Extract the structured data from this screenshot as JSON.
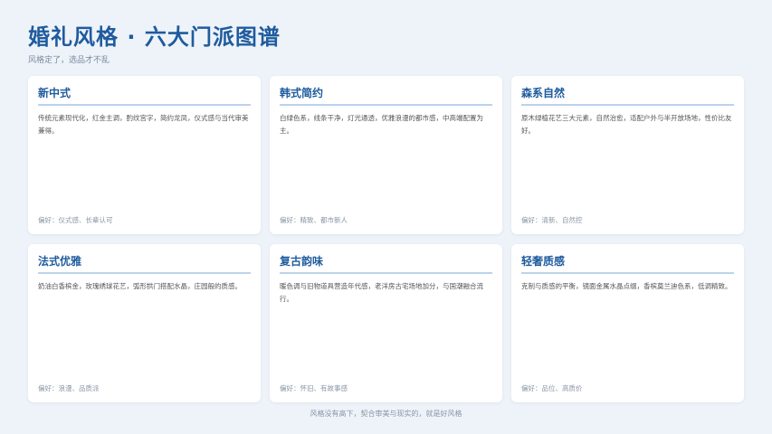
{
  "header": {
    "title": "婚礼风格 · 六大门派图谱",
    "subtitle": "风格定了，选品才不乱"
  },
  "cards": [
    {
      "title": "新中式",
      "desc": "传统元素现代化，红金主调，酌纹宫字，简约龙凤，仪式感与当代审美兼得。",
      "foot": "偏好：仪式感、长辈认可"
    },
    {
      "title": "韩式简约",
      "desc": "白绿色系，线条干净，灯光通透，优雅浪漫的都市感，中高端配置为主。",
      "foot": "偏好：精致、都市新人"
    },
    {
      "title": "森系自然",
      "desc": "原木绿植花艺三大元素，自然治愈，适配户外与半开放场地，性价比友好。",
      "foot": "偏好：清新、自然控"
    },
    {
      "title": "法式优雅",
      "desc": "奶油白香槟金，玫瑰绣球花艺，弧形拱门搭配水晶，庄园般的质感。",
      "foot": "偏好：浪漫、品质派"
    },
    {
      "title": "复古韵味",
      "desc": "暖色调与旧物道具营造年代感，老洋房古宅场地加分，与国潮融合流行。",
      "foot": "偏好：怀旧、有故事感"
    },
    {
      "title": "轻奢质感",
      "desc": "克制与质感的平衡，镜面金属水晶点缀，香槟奠兰迪色系，低调精致。",
      "foot": "偏好：品位、高质价"
    }
  ],
  "footer": {
    "text": "风格没有高下，契合审美与现实的，就是好风格"
  }
}
